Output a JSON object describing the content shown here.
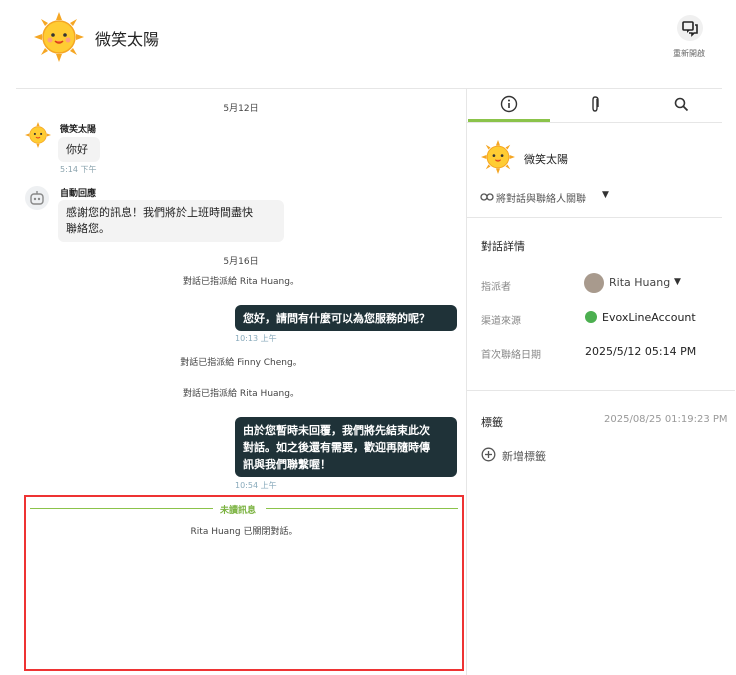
{
  "header": {
    "title": "微笑太陽",
    "new_chat_label": "重新開啟"
  },
  "messages": {
    "date1": "5月12日",
    "user_name": "微笑太陽",
    "user_msg": "你好",
    "user_time": "5:14 下午",
    "bot_name": "自動回應",
    "bot_msg_line1": "感謝您的訊息！我們將於上班時間盡快",
    "bot_msg_line2": "聯絡您。",
    "date2": "5月16日",
    "assign1": "對話已指派給 Rita Huang。",
    "agent_msg1": "您好，請問有什麼可以為您服務的呢？",
    "agent_time1": "10:13 上午",
    "assign2": "對話已指派給 Finny Cheng。",
    "assign3": "對話已指派給 Rita Huang。",
    "agent_msg2_line1": "由於您暫時未回覆，我們將先結束此次",
    "agent_msg2_line2": "對話。如之後還有需要，歡迎再隨時傳",
    "agent_msg2_line3": "訊與我們聯繫喔！",
    "agent_time2": "10:54 上午",
    "unread_label": "未讀訊息",
    "closed_text": "Rita Huang 已關閉對話。"
  },
  "panel": {
    "contact_name": "微笑太陽",
    "link_label": "將對話與聯絡人關聯",
    "details_title": "對話詳情",
    "assignee_label": "指派者",
    "assignee_value": "Rita Huang",
    "channel_label": "渠道來源",
    "channel_value": "EvoxLineAccount",
    "first_contact_label": "首次聯絡日期",
    "first_contact_value": "2025/5/12 05:14 PM",
    "tags_title": "標籤",
    "tags_time": "2025/08/25 01:19:23 PM",
    "add_tag_label": "新增標籤"
  },
  "colors": {
    "accent": "#8bc34a",
    "bubble_out": "#1f3238",
    "highlight_border": "#ee3333"
  }
}
